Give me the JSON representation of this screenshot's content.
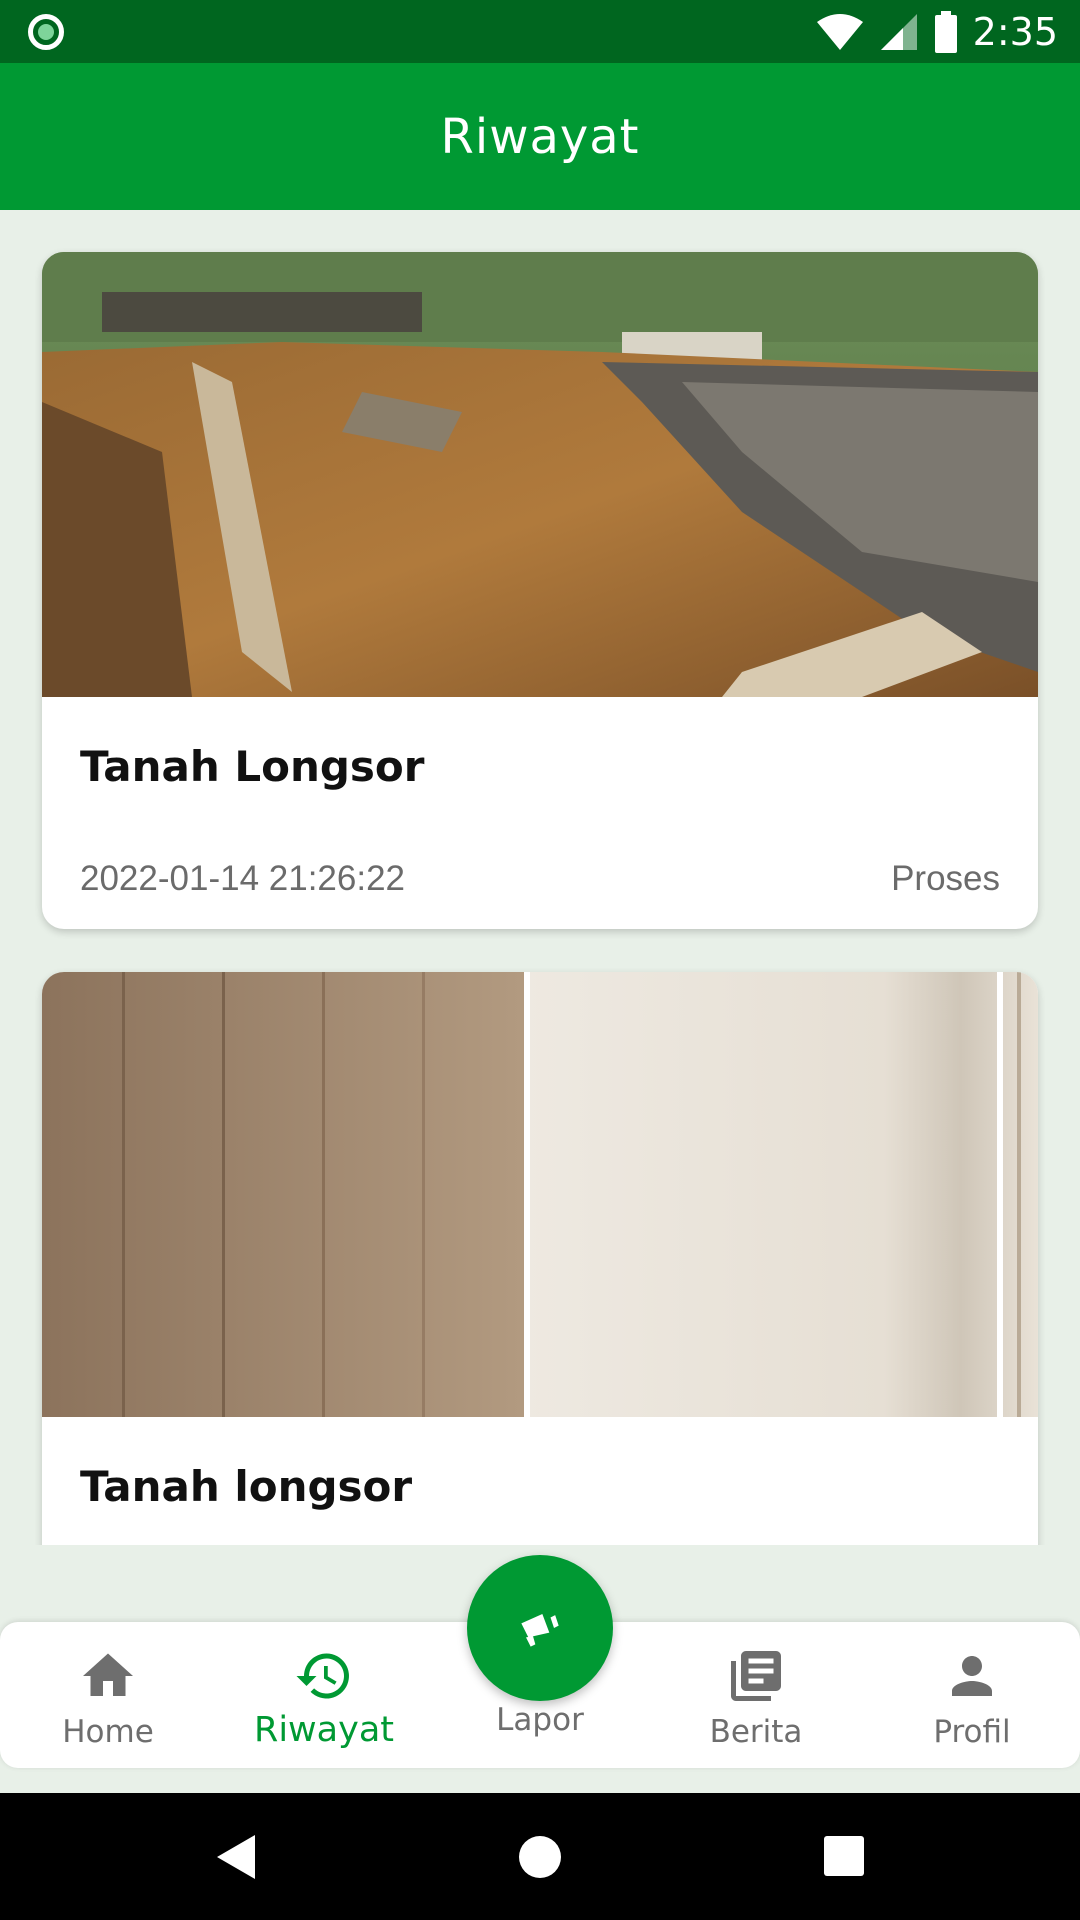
{
  "status_bar": {
    "time": "2:35"
  },
  "app_bar": {
    "title": "Riwayat"
  },
  "reports": [
    {
      "title": "Tanah Longsor",
      "date": "2022-01-14 21:26:22",
      "status": "Proses"
    },
    {
      "title": "Tanah longsor"
    }
  ],
  "bottom_nav": {
    "items": [
      {
        "label": "Home",
        "icon": "home-icon",
        "active": false
      },
      {
        "label": "Riwayat",
        "icon": "history-icon",
        "active": true
      },
      {
        "label": "Lapor",
        "icon": "megaphone-icon",
        "active": false
      },
      {
        "label": "Berita",
        "icon": "newspaper-icon",
        "active": false
      },
      {
        "label": "Profil",
        "icon": "person-icon",
        "active": false
      }
    ]
  },
  "colors": {
    "primary": "#009933",
    "status_bar": "#00661f",
    "background": "#e8f0e8"
  }
}
